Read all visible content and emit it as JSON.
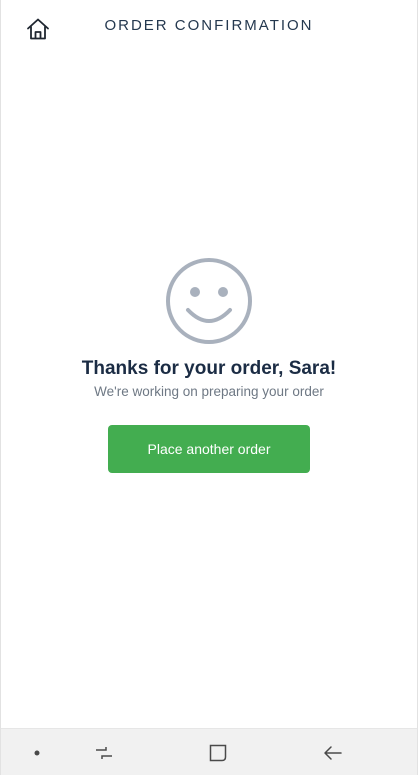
{
  "header": {
    "title": "ORDER CONFIRMATION",
    "home_icon": "home-icon"
  },
  "main": {
    "illustration_icon": "smiley-face-icon",
    "headline": "Thanks for your order, Sara!",
    "subline": "We're working on preparing your order",
    "primary_button_label": "Place another order"
  },
  "navbar": {
    "items": [
      {
        "icon": "dot-icon"
      },
      {
        "icon": "recent-apps-icon"
      },
      {
        "icon": "home-square-icon"
      },
      {
        "icon": "back-arrow-icon"
      }
    ]
  },
  "colors": {
    "title_text": "#24384f",
    "headline_text": "#1b2c44",
    "subline_text": "#6e7884",
    "primary_button": "#43ad50",
    "navbar_background": "#f1f1f1",
    "smiley_stroke": "#a9b1bd"
  }
}
